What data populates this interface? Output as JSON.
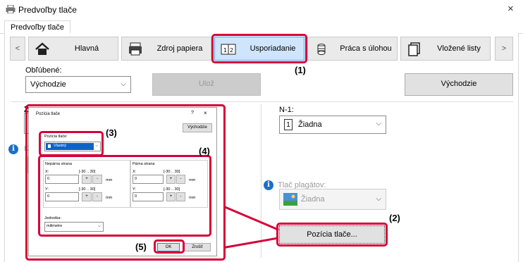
{
  "window": {
    "title": "Predvoľby tlače",
    "close": "×"
  },
  "tab": {
    "label": "Predvoľby tlače"
  },
  "nav": {
    "prev": "<",
    "next": ">",
    "items": [
      {
        "label": "Hlavná",
        "icon": "home-icon"
      },
      {
        "label": "Zdroj papiera",
        "icon": "paper-tray-icon"
      },
      {
        "label": "Usporiadanie",
        "icon": "layout-icon"
      },
      {
        "label": "Práca s úlohou",
        "icon": "job-stack-icon"
      },
      {
        "label": "Vložené listy",
        "icon": "inserted-sheets-icon"
      }
    ]
  },
  "favorites": {
    "label": "Obľúbené:",
    "value": "Východzie",
    "save": "Ulož",
    "default": "Východzie"
  },
  "partial": {
    "first_char": "2",
    "k_char": "K"
  },
  "nup": {
    "label": "N-1:",
    "value": "Žiadna",
    "icon_text": "1"
  },
  "poster": {
    "label": "Tlač plagátov:",
    "value": "Žiadna"
  },
  "print_position_button": "Pozícia tlače...",
  "callouts": {
    "c1": "(1)",
    "c2": "(2)",
    "c3": "(3)",
    "c4": "(4)",
    "c5": "(5)"
  },
  "dialog": {
    "title": "Pozícia tlače",
    "help": "?",
    "close": "×",
    "default_btn": "Východzie",
    "position_label": "Pozícia tlače:",
    "position_value": "Vlastný",
    "odd": {
      "title": "Nepárna strana",
      "x_label": "X:",
      "x_range": "[-30 .. 30]",
      "x_value": "0",
      "y_label": "Y:",
      "y_range": "[-30 .. 30]",
      "y_value": "0"
    },
    "even": {
      "title": "Párna strana",
      "x_label": "X:",
      "x_range": "[-30 .. 30]",
      "x_value": "0",
      "y_label": "Y:",
      "y_range": "[-30 .. 30]",
      "y_value": "0"
    },
    "unit": "mm",
    "plus": "+",
    "minus": "-",
    "units_label": "Jednotka:",
    "units_value": "milimetre",
    "ok": "OK",
    "cancel": "Zrušiť"
  },
  "colors": {
    "accent_red": "#d6003a",
    "active_tab": "#cfe5fb",
    "info_blue": "#1f6ec7"
  }
}
